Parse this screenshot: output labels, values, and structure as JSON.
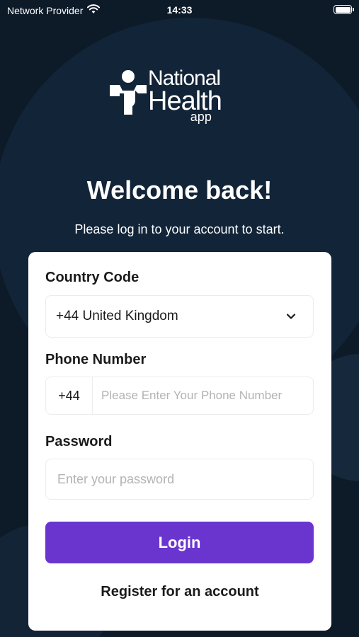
{
  "status_bar": {
    "carrier": "Network Provider",
    "time": "14:33",
    "wifi_icon": "wifi-icon",
    "battery_icon": "battery-icon"
  },
  "logo": {
    "line1": "National",
    "line2": "Health",
    "line3": "app",
    "icon": "health-person-icon"
  },
  "header": {
    "title": "Welcome back!",
    "subtitle": "Please log in to your account to start."
  },
  "form": {
    "country_code": {
      "label": "Country Code",
      "selected": "+44 United Kingdom",
      "icon": "chevron-down-icon"
    },
    "phone": {
      "label": "Phone Number",
      "prefix": "+44",
      "value": "",
      "placeholder": "Please Enter Your Phone Number"
    },
    "password": {
      "label": "Password",
      "value": "",
      "placeholder": "Enter your password"
    },
    "login_label": "Login",
    "register_label": "Register for an account"
  },
  "colors": {
    "background": "#0d1a28",
    "primary": "#6a35cf",
    "card": "#ffffff"
  }
}
